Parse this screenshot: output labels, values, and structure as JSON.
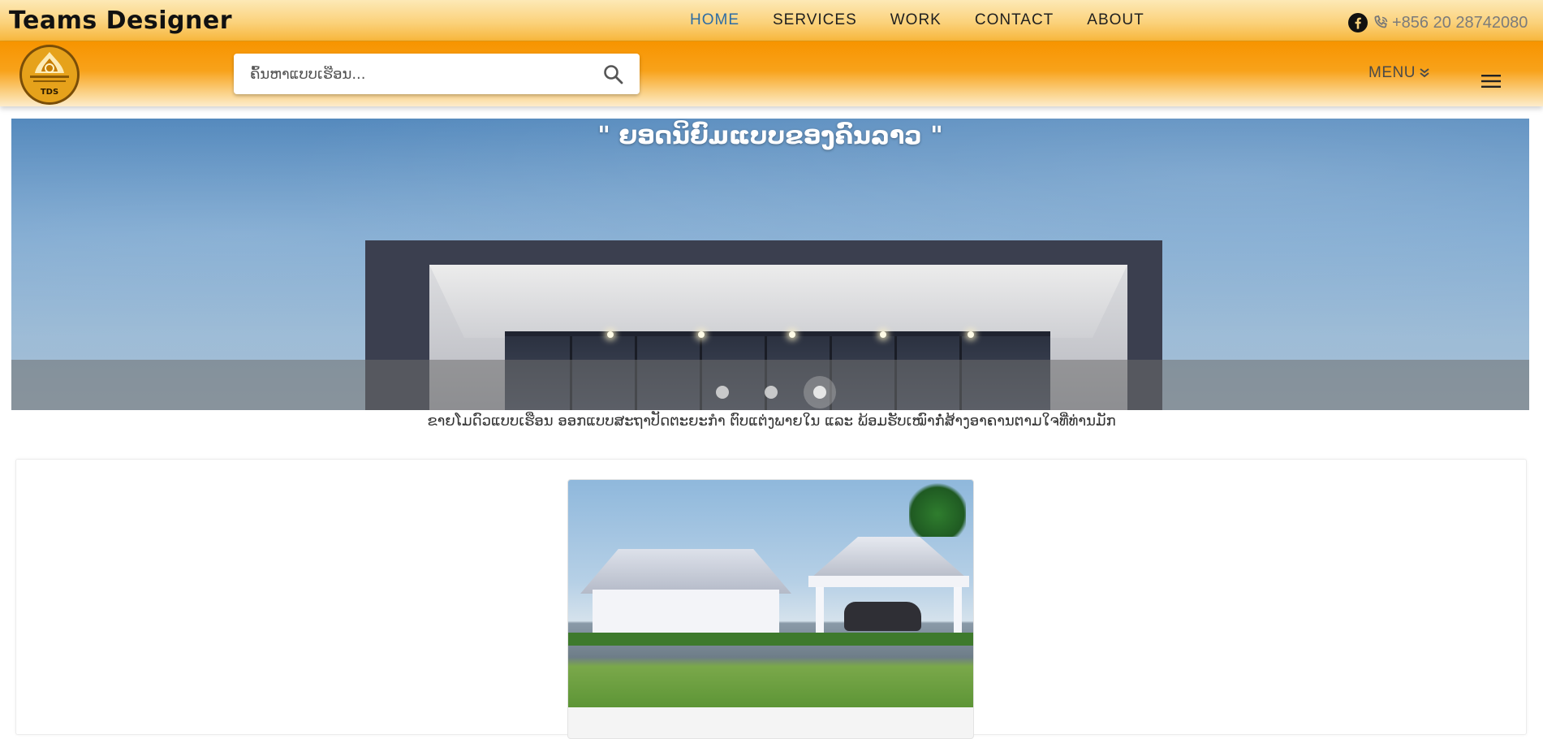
{
  "header": {
    "brand": "Teams Designer",
    "nav": [
      {
        "label": "HOME",
        "active": true
      },
      {
        "label": "SERVICES",
        "active": false
      },
      {
        "label": "WORK",
        "active": false
      },
      {
        "label": "CONTACT",
        "active": false
      },
      {
        "label": "ABOUT",
        "active": false
      }
    ],
    "phone": "+856 20 28742080",
    "icons": {
      "facebook": "facebook-icon",
      "phone": "phone-icon"
    }
  },
  "toolbar": {
    "logo_text": "TDS",
    "search_placeholder": "ຄົ້ນຫາແບບເຮືອນ...",
    "search_icon": "search-icon",
    "menu_label": "MENU",
    "menu_icon": "chevron-double-down-icon",
    "hamburger_icon": "hamburger-menu-icon"
  },
  "hero": {
    "title": "\" ຍອດນິຍົມແບບຂອງຄົນລາວ \"",
    "slides_count": 3,
    "active_slide": 3,
    "caption": "ຂາຍໂມດົວແບບເຮືອນ ອອກແບບສະຖາປັດຕະຍະກຳ ຕົບແຕ່ງພາຍໃນ ແລະ ພ້ອມຮັບເໝົາກໍ່ສ້າງອາຄານຕາມໃຈທີ່ທ່ານມັກ"
  },
  "colors": {
    "accent_orange": "#f79400",
    "nav_active": "#2e6da4",
    "phone_text": "#7b7b7b"
  }
}
